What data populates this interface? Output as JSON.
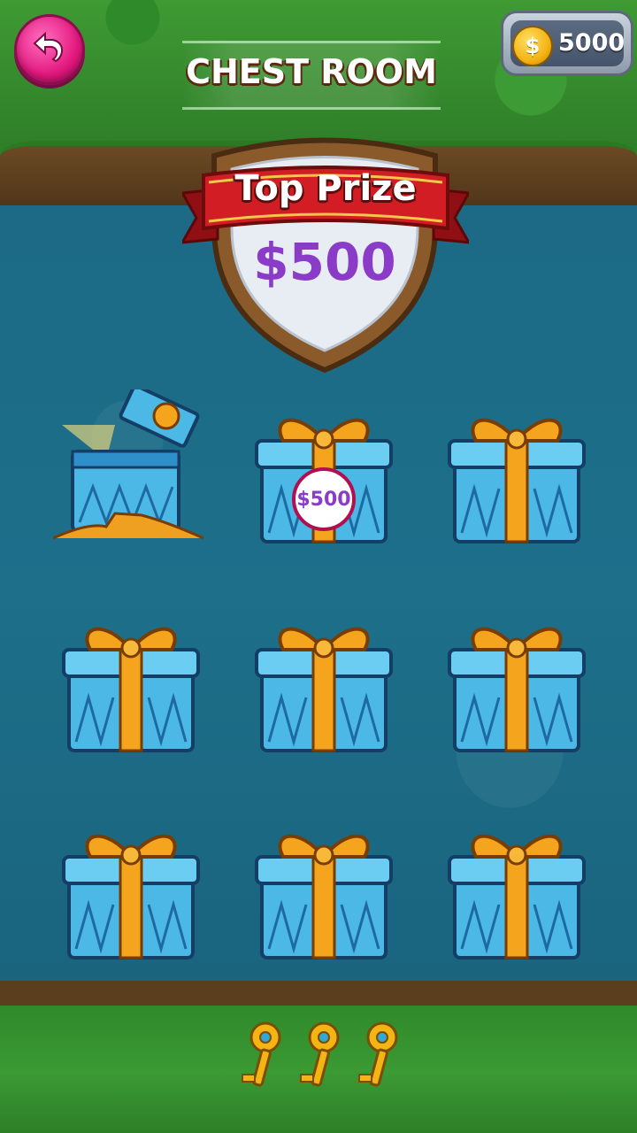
{
  "header": {
    "title": "CHEST ROOM",
    "coins": "5000",
    "coin_symbol": "$"
  },
  "top_prize": {
    "label": "Top Prize",
    "amount": "$500"
  },
  "chests": {
    "revealed_prize": "$500",
    "count": 9,
    "opened_index": 0,
    "revealed_index": 1
  },
  "keys": {
    "count": 3
  },
  "icons": {
    "back": "back-arrow-icon",
    "coin": "coin-icon",
    "key": "key-icon",
    "chest": "gift-chest-icon"
  },
  "colors": {
    "back_button": "#e3197f",
    "prize_text": "#8a3cc8",
    "ribbon": "#c4161c",
    "gift_box": "#4bb8e6",
    "gift_ribbon": "#f5a41e"
  }
}
